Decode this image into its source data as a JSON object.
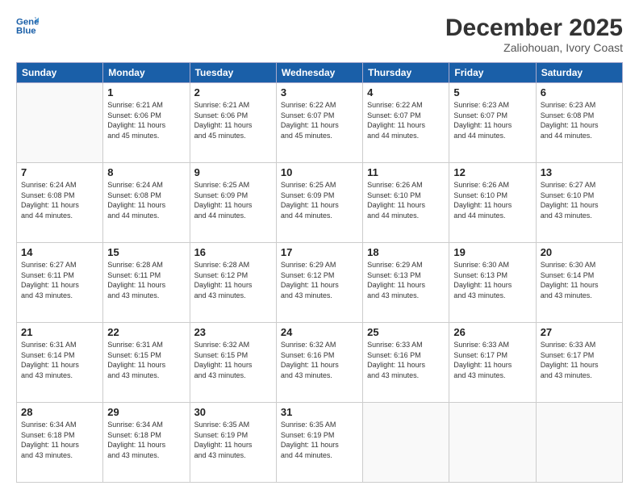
{
  "header": {
    "logo_line1": "General",
    "logo_line2": "Blue",
    "month": "December 2025",
    "location": "Zaliohouan, Ivory Coast"
  },
  "days_of_week": [
    "Sunday",
    "Monday",
    "Tuesday",
    "Wednesday",
    "Thursday",
    "Friday",
    "Saturday"
  ],
  "weeks": [
    [
      {
        "day": "",
        "info": ""
      },
      {
        "day": "1",
        "info": "Sunrise: 6:21 AM\nSunset: 6:06 PM\nDaylight: 11 hours\nand 45 minutes."
      },
      {
        "day": "2",
        "info": "Sunrise: 6:21 AM\nSunset: 6:06 PM\nDaylight: 11 hours\nand 45 minutes."
      },
      {
        "day": "3",
        "info": "Sunrise: 6:22 AM\nSunset: 6:07 PM\nDaylight: 11 hours\nand 45 minutes."
      },
      {
        "day": "4",
        "info": "Sunrise: 6:22 AM\nSunset: 6:07 PM\nDaylight: 11 hours\nand 44 minutes."
      },
      {
        "day": "5",
        "info": "Sunrise: 6:23 AM\nSunset: 6:07 PM\nDaylight: 11 hours\nand 44 minutes."
      },
      {
        "day": "6",
        "info": "Sunrise: 6:23 AM\nSunset: 6:08 PM\nDaylight: 11 hours\nand 44 minutes."
      }
    ],
    [
      {
        "day": "7",
        "info": "Sunrise: 6:24 AM\nSunset: 6:08 PM\nDaylight: 11 hours\nand 44 minutes."
      },
      {
        "day": "8",
        "info": "Sunrise: 6:24 AM\nSunset: 6:08 PM\nDaylight: 11 hours\nand 44 minutes."
      },
      {
        "day": "9",
        "info": "Sunrise: 6:25 AM\nSunset: 6:09 PM\nDaylight: 11 hours\nand 44 minutes."
      },
      {
        "day": "10",
        "info": "Sunrise: 6:25 AM\nSunset: 6:09 PM\nDaylight: 11 hours\nand 44 minutes."
      },
      {
        "day": "11",
        "info": "Sunrise: 6:26 AM\nSunset: 6:10 PM\nDaylight: 11 hours\nand 44 minutes."
      },
      {
        "day": "12",
        "info": "Sunrise: 6:26 AM\nSunset: 6:10 PM\nDaylight: 11 hours\nand 44 minutes."
      },
      {
        "day": "13",
        "info": "Sunrise: 6:27 AM\nSunset: 6:10 PM\nDaylight: 11 hours\nand 43 minutes."
      }
    ],
    [
      {
        "day": "14",
        "info": "Sunrise: 6:27 AM\nSunset: 6:11 PM\nDaylight: 11 hours\nand 43 minutes."
      },
      {
        "day": "15",
        "info": "Sunrise: 6:28 AM\nSunset: 6:11 PM\nDaylight: 11 hours\nand 43 minutes."
      },
      {
        "day": "16",
        "info": "Sunrise: 6:28 AM\nSunset: 6:12 PM\nDaylight: 11 hours\nand 43 minutes."
      },
      {
        "day": "17",
        "info": "Sunrise: 6:29 AM\nSunset: 6:12 PM\nDaylight: 11 hours\nand 43 minutes."
      },
      {
        "day": "18",
        "info": "Sunrise: 6:29 AM\nSunset: 6:13 PM\nDaylight: 11 hours\nand 43 minutes."
      },
      {
        "day": "19",
        "info": "Sunrise: 6:30 AM\nSunset: 6:13 PM\nDaylight: 11 hours\nand 43 minutes."
      },
      {
        "day": "20",
        "info": "Sunrise: 6:30 AM\nSunset: 6:14 PM\nDaylight: 11 hours\nand 43 minutes."
      }
    ],
    [
      {
        "day": "21",
        "info": "Sunrise: 6:31 AM\nSunset: 6:14 PM\nDaylight: 11 hours\nand 43 minutes."
      },
      {
        "day": "22",
        "info": "Sunrise: 6:31 AM\nSunset: 6:15 PM\nDaylight: 11 hours\nand 43 minutes."
      },
      {
        "day": "23",
        "info": "Sunrise: 6:32 AM\nSunset: 6:15 PM\nDaylight: 11 hours\nand 43 minutes."
      },
      {
        "day": "24",
        "info": "Sunrise: 6:32 AM\nSunset: 6:16 PM\nDaylight: 11 hours\nand 43 minutes."
      },
      {
        "day": "25",
        "info": "Sunrise: 6:33 AM\nSunset: 6:16 PM\nDaylight: 11 hours\nand 43 minutes."
      },
      {
        "day": "26",
        "info": "Sunrise: 6:33 AM\nSunset: 6:17 PM\nDaylight: 11 hours\nand 43 minutes."
      },
      {
        "day": "27",
        "info": "Sunrise: 6:33 AM\nSunset: 6:17 PM\nDaylight: 11 hours\nand 43 minutes."
      }
    ],
    [
      {
        "day": "28",
        "info": "Sunrise: 6:34 AM\nSunset: 6:18 PM\nDaylight: 11 hours\nand 43 minutes."
      },
      {
        "day": "29",
        "info": "Sunrise: 6:34 AM\nSunset: 6:18 PM\nDaylight: 11 hours\nand 43 minutes."
      },
      {
        "day": "30",
        "info": "Sunrise: 6:35 AM\nSunset: 6:19 PM\nDaylight: 11 hours\nand 43 minutes."
      },
      {
        "day": "31",
        "info": "Sunrise: 6:35 AM\nSunset: 6:19 PM\nDaylight: 11 hours\nand 44 minutes."
      },
      {
        "day": "",
        "info": ""
      },
      {
        "day": "",
        "info": ""
      },
      {
        "day": "",
        "info": ""
      }
    ]
  ]
}
